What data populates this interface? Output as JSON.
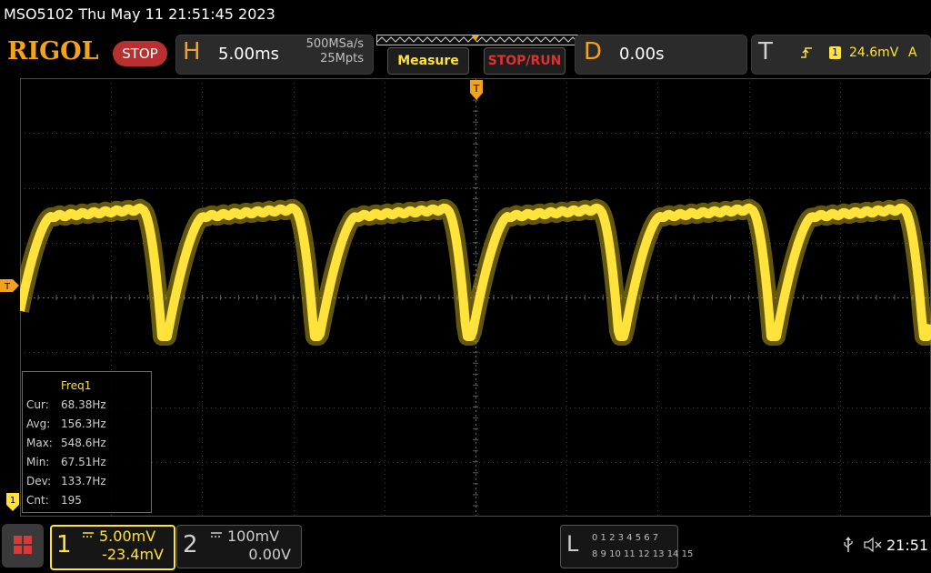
{
  "title_bar": {
    "text": "MSO5102  Thu May 11 21:51:45 2023"
  },
  "header": {
    "logo": "RIGOL",
    "run_state": "STOP",
    "horizontal": {
      "letter": "H",
      "timebase": "5.00ms",
      "sample_rate": "500MSa/s",
      "memory_depth": "25Mpts"
    },
    "measure_button": "Measure",
    "stop_run_button": "STOP/RUN",
    "delay": {
      "letter": "D",
      "value": "0.00s"
    },
    "trigger": {
      "letter": "T",
      "source": "1",
      "level": "24.6mV",
      "mode": "A"
    }
  },
  "markers": {
    "trigger_position": "T",
    "trigger_level": "T",
    "channel": "1"
  },
  "measurement": {
    "title": "Freq1",
    "rows": [
      {
        "label": "Cur:",
        "value": "68.38Hz"
      },
      {
        "label": "Avg:",
        "value": "156.3Hz"
      },
      {
        "label": "Max:",
        "value": "548.6Hz"
      },
      {
        "label": "Min:",
        "value": "67.51Hz"
      },
      {
        "label": "Dev:",
        "value": "133.7Hz"
      },
      {
        "label": "Cnt:",
        "value": "195"
      }
    ]
  },
  "channels": {
    "ch1": {
      "number": "1",
      "scale": "5.00mV",
      "offset": "-23.4mV"
    },
    "ch2": {
      "number": "2",
      "scale": "100mV",
      "offset": "0.00V"
    }
  },
  "logic_analyzer": {
    "letter": "L",
    "row1": "0 1 2 3  4 5 6 7",
    "row2": "8 9 10 11 12 13 14 15"
  },
  "status": {
    "time": "21:51"
  },
  "colors": {
    "ch1": "#ffe23a",
    "accent": "#f2a31b",
    "stop": "#b83030",
    "grid": "#3c3c3c"
  }
}
